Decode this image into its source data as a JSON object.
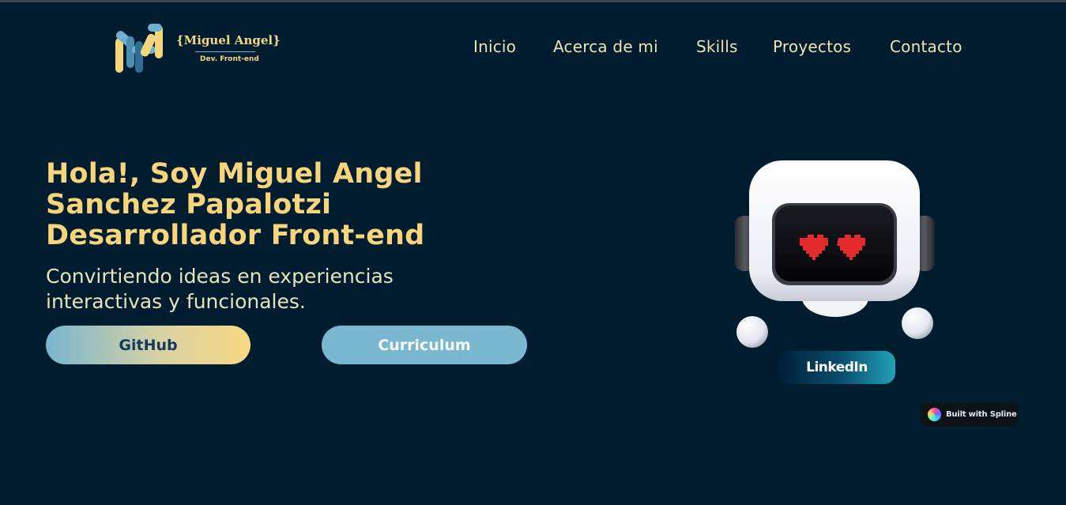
{
  "header": {
    "logo": {
      "monogram": "MA",
      "name": "{Miguel Angel}",
      "subtitle": "Dev. Front-end"
    },
    "nav": [
      {
        "label": "Inicio"
      },
      {
        "label": "Acerca de mi"
      },
      {
        "label": "Skills"
      },
      {
        "label": "Proyectos"
      },
      {
        "label": "Contacto"
      }
    ]
  },
  "hero": {
    "title_lines": [
      "Hola!, Soy Miguel Angel",
      "Sanchez Papalotzi",
      "Desarrollador Front-end"
    ],
    "subtitle_lines": [
      "Convirtiendo ideas en experiencias",
      "interactivas y funcionales."
    ],
    "buttons": {
      "github": "GitHub",
      "curriculum": "Curriculum"
    }
  },
  "spline": {
    "robot_icon": "robot-heart-eyes-icon",
    "linkedin_label": "LinkedIn",
    "badge_label": "Built with Spline"
  },
  "colors": {
    "background": "#001c2f",
    "accent_yellow": "#f8d47d",
    "accent_blue": "#7ab7d1",
    "nav_text": "#efe3b3"
  }
}
